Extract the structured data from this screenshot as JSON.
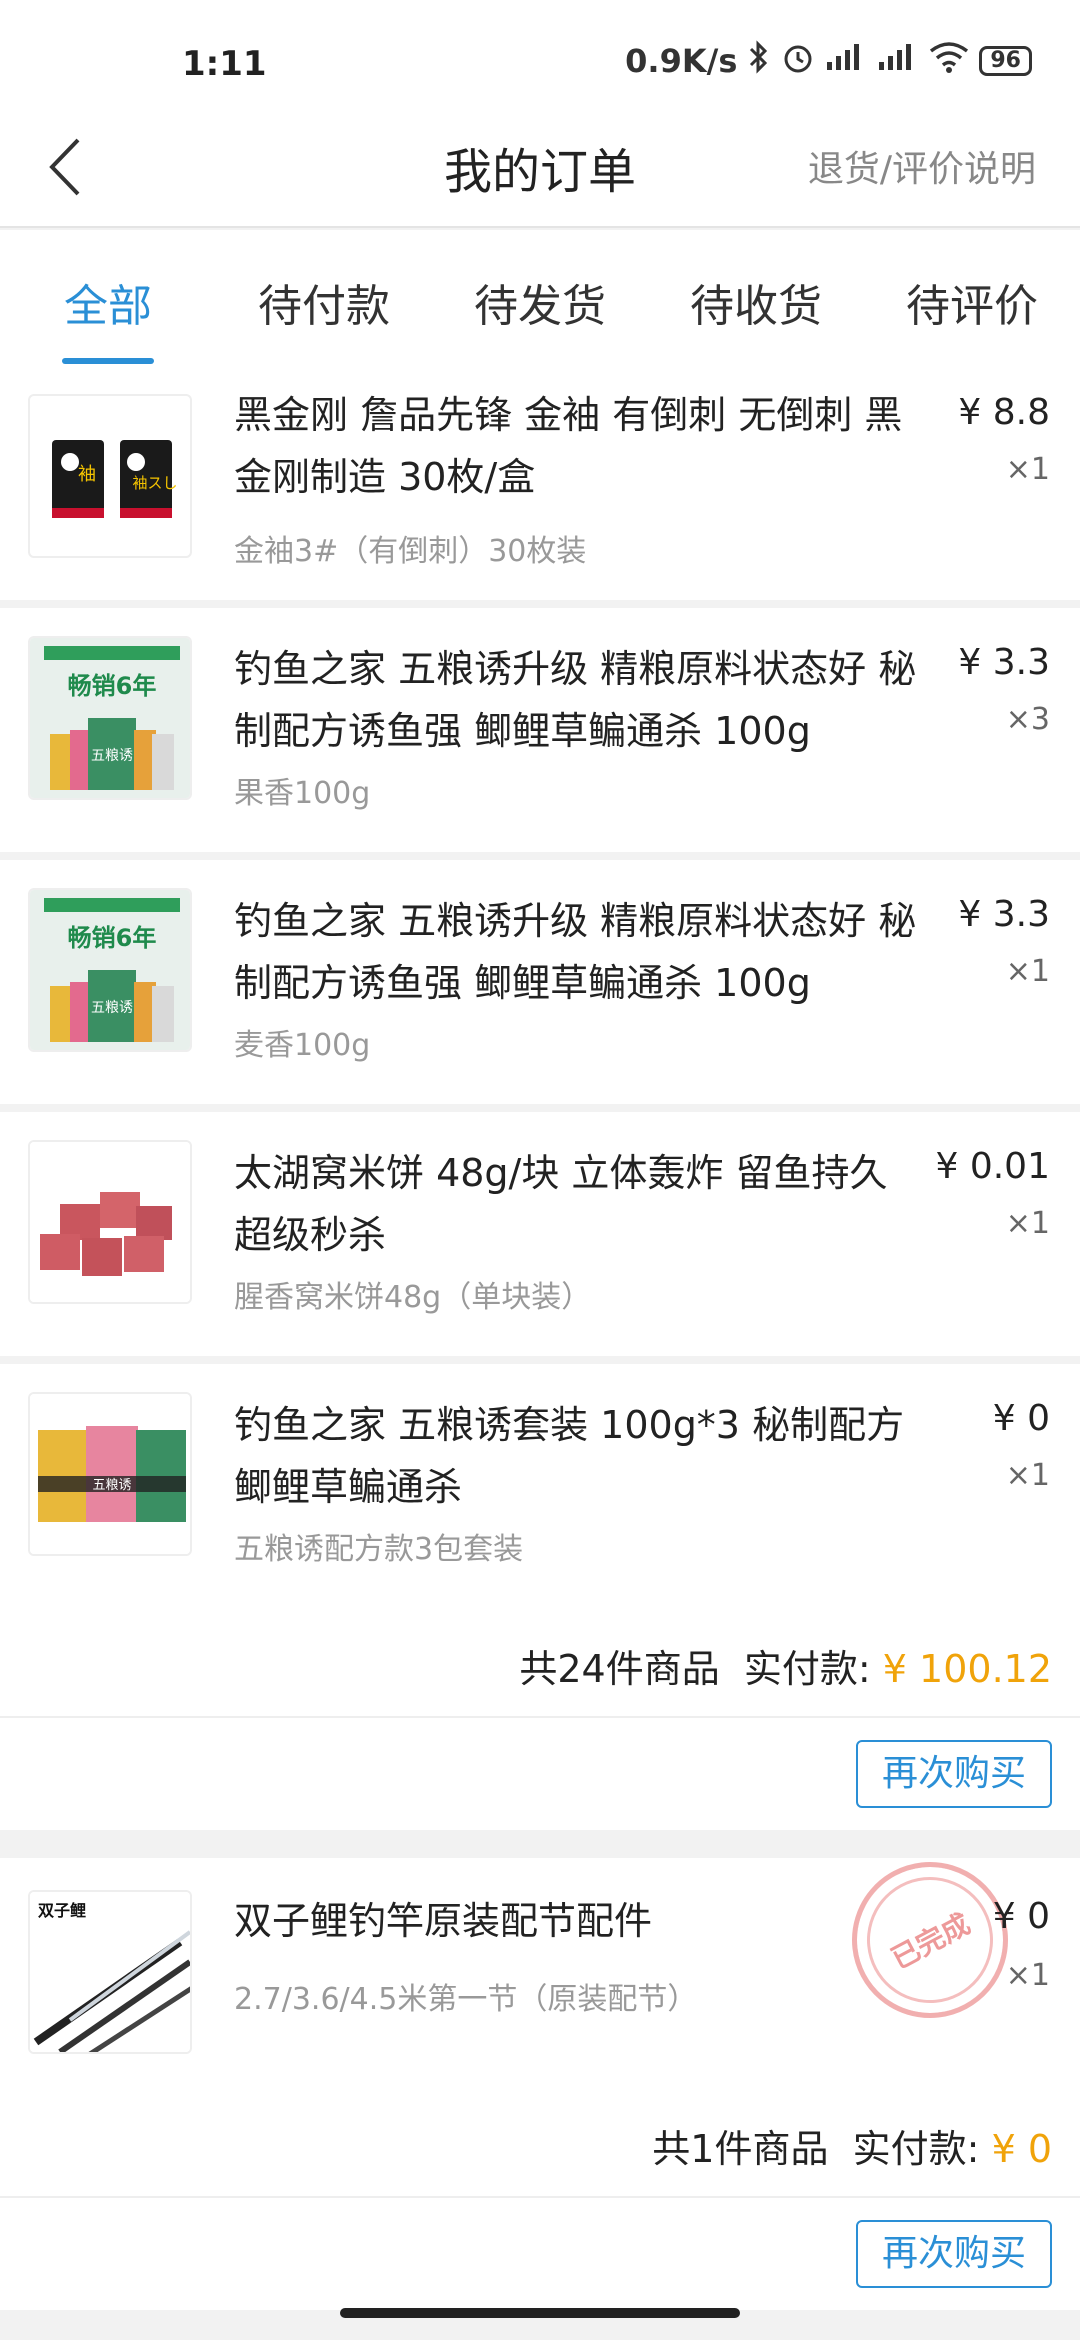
{
  "status_bar": {
    "time": "1:11",
    "net_speed": "0.9K/s",
    "battery": "96"
  },
  "header": {
    "title": "我的订单",
    "help_link": "退货/评价说明"
  },
  "tabs": [
    "全部",
    "待付款",
    "待发货",
    "待收货",
    "待评价"
  ],
  "orders": [
    {
      "items": [
        {
          "title": "黑金刚 詹品先锋 金袖 有倒刺 无倒刺 黑金刚制造 30枚/盒",
          "variant": "金袖3#（有倒刺）30枚装",
          "price": "¥ 8.8",
          "qty": "×1"
        },
        {
          "title": "钓鱼之家 五粮诱升级 精粮原料状态好 秘制配方诱鱼强 鲫鲤草鳊通杀 100g",
          "variant": "果香100g",
          "price": "¥ 3.3",
          "qty": "×3"
        },
        {
          "title": "钓鱼之家 五粮诱升级 精粮原料状态好 秘制配方诱鱼强 鲫鲤草鳊通杀 100g",
          "variant": "麦香100g",
          "price": "¥ 3.3",
          "qty": "×1"
        },
        {
          "title": "太湖窝米饼 48g/块 立体轰炸 留鱼持久 超级秒杀",
          "variant": "腥香窝米饼48g（单块装）",
          "price": "¥ 0.01",
          "qty": "×1"
        },
        {
          "title": "钓鱼之家 五粮诱套装 100g*3 秘制配方 鲫鲤草鳊通杀",
          "variant": "五粮诱配方款3包套装",
          "price": "¥ 0",
          "qty": "×1"
        }
      ],
      "summary_count": "共24件商品",
      "summary_label": "实付款:",
      "summary_amount": "¥ 100.12",
      "rebuy": "再次购买"
    },
    {
      "items": [
        {
          "title": "双子鲤钓竿原装配节配件",
          "variant": "2.7/3.6/4.5米第一节（原装配节）",
          "price": "¥ 0",
          "qty": "×1"
        }
      ],
      "stamp": "已完成",
      "summary_count": "共1件商品",
      "summary_label": "实付款:",
      "summary_amount": "¥ 0",
      "rebuy": "再次购买"
    }
  ],
  "thumbnails": {
    "hook_brand_text": "袖",
    "hook_brand_text2": "袖スし",
    "bait_banner": "畅销6年",
    "bait_name": "五粮诱",
    "rod_brand": "双子鲤"
  },
  "colors": {
    "accent": "#2a8fd6",
    "amount": "#f0a30a"
  }
}
